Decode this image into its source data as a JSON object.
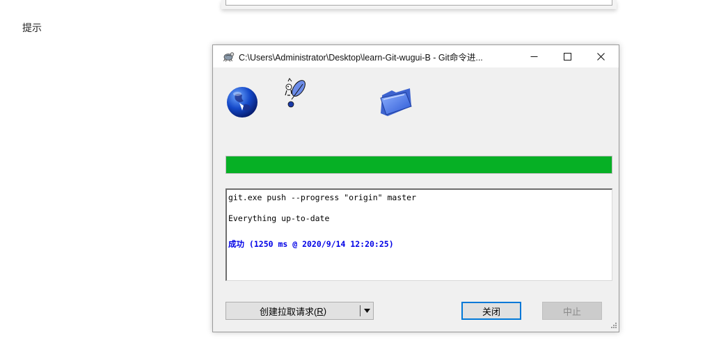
{
  "page": {
    "label": "提示"
  },
  "window": {
    "title": "C:\\Users\\Administrator\\Desktop\\learn-Git-wugui-B - Git命令进...",
    "progress": 1.0,
    "colors": {
      "progress": "#06b025",
      "success_text": "#0000e6",
      "focus_border": "#0078d7"
    },
    "icons": [
      "tortoisegit-app-icon",
      "globe-icon",
      "tortoise-mascot-icon",
      "folder-icon",
      "minimize-icon",
      "maximize-icon",
      "close-icon",
      "dropdown-arrow-icon",
      "resize-grip-icon"
    ],
    "log": {
      "lines": [
        "git.exe push --progress \"origin\" master",
        "Everything up-to-date",
        "成功 (1250 ms @ 2020/9/14 12:20:25)"
      ]
    },
    "buttons": {
      "pull_request_label": "创建拉取请求(",
      "pull_request_hotkey": "R",
      "pull_request_suffix": ")",
      "close": "关闭",
      "stop": "中止"
    }
  }
}
